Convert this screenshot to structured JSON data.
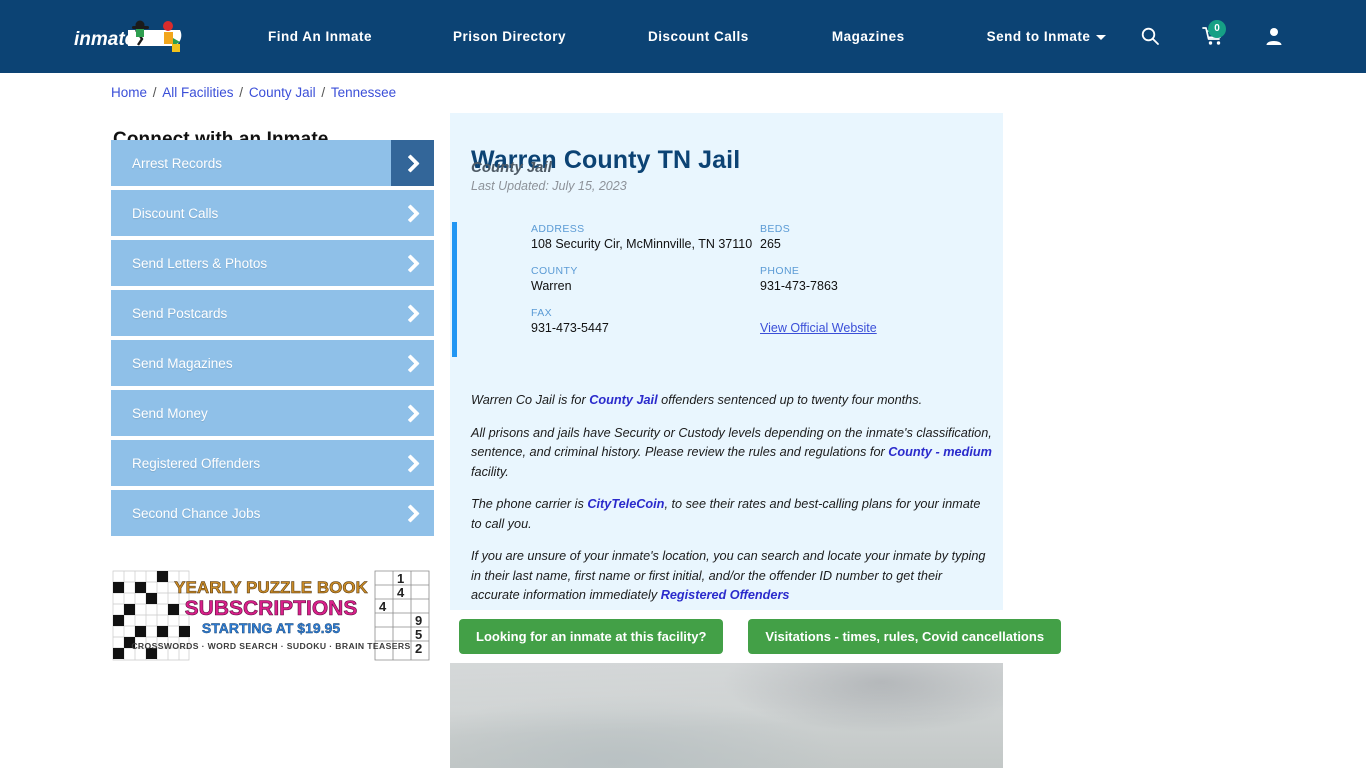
{
  "header": {
    "logo_alt": "inmateAID",
    "logo_text_primary": "inmate",
    "logo_text_secondary": "AID",
    "nav": [
      {
        "label": "Find An Inmate",
        "icon": ""
      },
      {
        "label": "Prison Directory",
        "icon": ""
      },
      {
        "label": "Discount Calls",
        "icon": ""
      },
      {
        "label": "Magazines",
        "icon": ""
      },
      {
        "label": "Send to Inmate",
        "icon": "chevron-down-icon",
        "has_caret": true
      }
    ],
    "icons": {
      "search": "search-icon",
      "cart": "shopping-cart-icon",
      "account": "user-account-icon"
    },
    "cart_count": "0",
    "bg_color": "#0c4374",
    "badge_color": "#16a085"
  },
  "breadcrumb": {
    "items": [
      "Home",
      "All Facilities",
      "County Jail",
      "Tennessee"
    ],
    "separator": "/"
  },
  "sidebar": {
    "title": "Connect with an Inmate",
    "items": [
      {
        "label": "Arrest Records",
        "active": true
      },
      {
        "label": "Discount Calls",
        "active": false
      },
      {
        "label": "Send Letters & Photos",
        "active": false
      },
      {
        "label": "Send Postcards",
        "active": false
      },
      {
        "label": "Send Magazines",
        "active": false
      },
      {
        "label": "Send Money",
        "active": false
      },
      {
        "label": "Registered Offenders",
        "active": false
      },
      {
        "label": "Second Chance Jobs",
        "active": false
      }
    ],
    "button_color": "#8fc0e8",
    "active_arrow_color": "#336699"
  },
  "ad": {
    "line1": "YEARLY PUZZLE BOOK",
    "line2": "SUBSCRIPTIONS",
    "line3": "STARTING AT $19.95",
    "line4": "CROSSWORDS · WORD SEARCH · SUDOKU · BRAIN TEASERS",
    "sudoku_digits": [
      "1",
      "4",
      "4",
      "9",
      "5",
      "2"
    ]
  },
  "facility": {
    "name": "Warren County TN Jail",
    "type": "County Jail",
    "last_updated": "Last Updated: July 15, 2023",
    "fields_left": [
      {
        "label": "ADDRESS",
        "value": "108 Security Cir, McMinnville, TN 37110"
      },
      {
        "label": "COUNTY",
        "value": "Warren"
      },
      {
        "label": "FAX",
        "value": "931-473-5447"
      }
    ],
    "fields_right": [
      {
        "label": "BEDS",
        "value": "265"
      },
      {
        "label": "PHONE",
        "value": "931-473-7863"
      }
    ],
    "official_website_link": "View Official Website",
    "accent_bar_color": "#2196f3",
    "card_bg": "#e9f6fe"
  },
  "description": {
    "p1_a": "Warren Co Jail is for ",
    "p1_link": "County Jail",
    "p1_b": " offenders sentenced up to twenty four months.",
    "p2_a": "All prisons and jails have Security or Custody levels depending on the inmate's classification, sentence, and criminal history. Please review the rules and regulations for ",
    "p2_link": "County - medium",
    "p2_b": " facility.",
    "p3_a": "The phone carrier is ",
    "p3_link": "CityTeleCoin",
    "p3_b": ", to see their rates and best-calling plans for your inmate to call you.",
    "p4_a": "If you are unsure of your inmate's location, you can search and locate your inmate by typing in their last name, first name or first initial, and/or the offender ID number to get their accurate information immediately ",
    "p4_link": "Registered Offenders",
    "p4_b": ""
  },
  "actions": {
    "primary": "Looking for an inmate at this facility?",
    "secondary": "Visitations - times, rules, Covid cancellations",
    "color": "#43a047"
  },
  "photo": {
    "alt": "Facility photograph - overcast sky"
  }
}
